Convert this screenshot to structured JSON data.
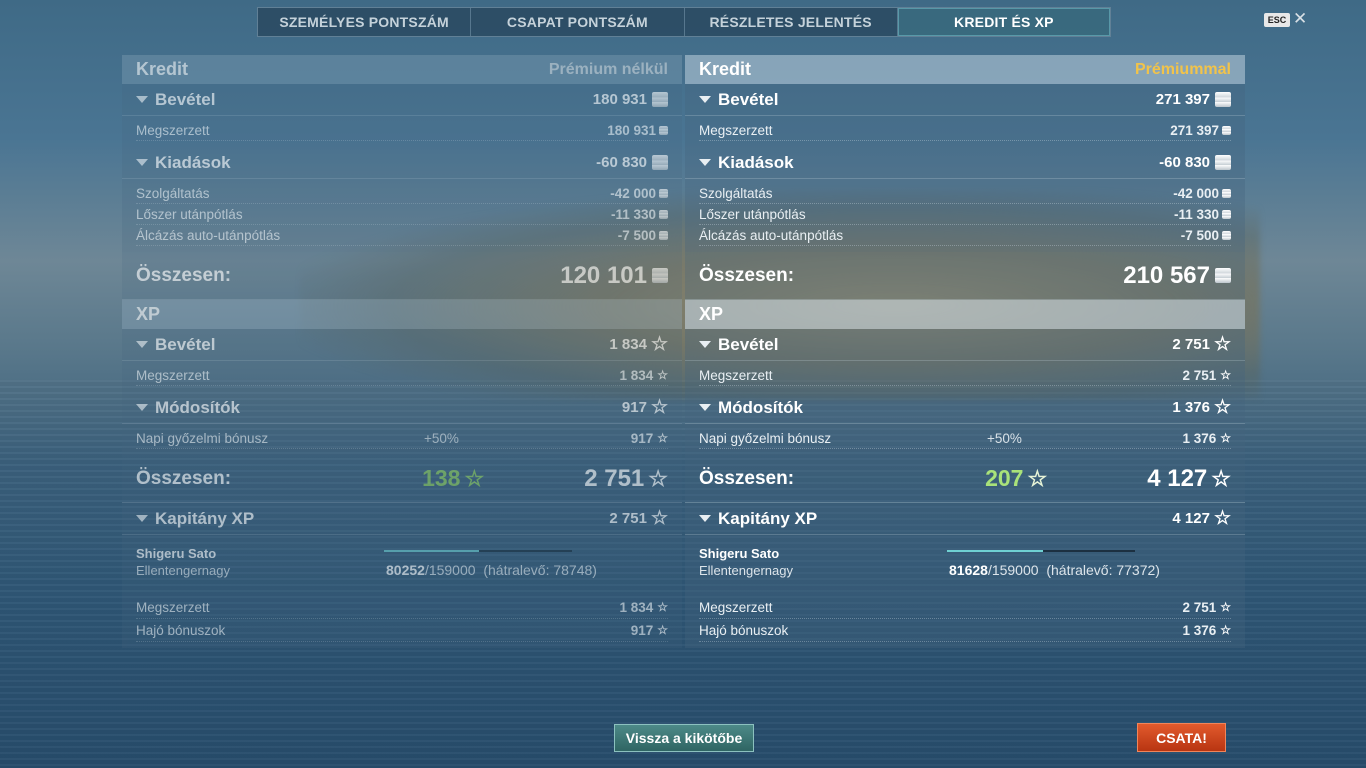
{
  "tabs": [
    "SZEMÉLYES PONTSZÁM",
    "CSAPAT PONTSZÁM",
    "RÉSZLETES JELENTÉS",
    "KREDIT ÉS XP"
  ],
  "active_tab": "KREDIT ÉS XP",
  "esc_label": "ESC",
  "close_symbol": "✕",
  "left": {
    "credit_title": "Kredit",
    "credit_sub": "Prémium nélkül",
    "income_label": "Bevétel",
    "income_value": "180 931",
    "earned_label": "Megszerzett",
    "earned_value": "180 931",
    "expenses_label": "Kiadások",
    "expenses_value": "-60 830",
    "service_label": "Szolgáltatás",
    "service_value": "-42 000",
    "ammo_label": "Lőszer utánpótlás",
    "ammo_value": "-11 330",
    "camo_label": "Álcázás auto-utánpótlás",
    "camo_value": "-7 500",
    "credit_total_label": "Összesen:",
    "credit_total_value": "120 101",
    "xp_title": "XP",
    "xp_income_label": "Bevétel",
    "xp_income_value": "1 834",
    "xp_earned_label": "Megszerzett",
    "xp_earned_value": "1 834",
    "modifiers_label": "Módosítók",
    "modifiers_value": "917",
    "daily_label": "Napi győzelmi bónusz",
    "daily_percent": "+50%",
    "daily_value": "917",
    "xp_total_label": "Összesen:",
    "xp_total_free": "138",
    "xp_total_value": "2 751",
    "captain_label": "Kapitány XP",
    "captain_value": "2 751",
    "captain_name": "Shigeru Sato",
    "captain_role": "Ellentengernagy",
    "captain_current": "80252",
    "captain_max": "/159000",
    "captain_remaining": "(hátralevő: 78748)",
    "captain_progress": 0.505,
    "cap_earned_label": "Megszerzett",
    "cap_earned_value": "1 834",
    "ship_bonus_label": "Hajó bónuszok",
    "ship_bonus_value": "917"
  },
  "right": {
    "credit_title": "Kredit",
    "credit_sub": "Prémiummal",
    "income_label": "Bevétel",
    "income_value": "271 397",
    "earned_label": "Megszerzett",
    "earned_value": "271 397",
    "expenses_label": "Kiadások",
    "expenses_value": "-60 830",
    "service_label": "Szolgáltatás",
    "service_value": "-42 000",
    "ammo_label": "Lőszer utánpótlás",
    "ammo_value": "-11 330",
    "camo_label": "Álcázás auto-utánpótlás",
    "camo_value": "-7 500",
    "credit_total_label": "Összesen:",
    "credit_total_value": "210 567",
    "xp_title": "XP",
    "xp_income_label": "Bevétel",
    "xp_income_value": "2 751",
    "xp_earned_label": "Megszerzett",
    "xp_earned_value": "2 751",
    "modifiers_label": "Módosítók",
    "modifiers_value": "1 376",
    "daily_label": "Napi győzelmi bónusz",
    "daily_percent": "+50%",
    "daily_value": "1 376",
    "xp_total_label": "Összesen:",
    "xp_total_free": "207",
    "xp_total_value": "4 127",
    "captain_label": "Kapitány XP",
    "captain_value": "4 127",
    "captain_name": "Shigeru Sato",
    "captain_role": "Ellentengernagy",
    "captain_current": "81628",
    "captain_max": "/159000",
    "captain_remaining": "(hátralevő: 77372)",
    "captain_progress": 0.513,
    "cap_earned_label": "Megszerzett",
    "cap_earned_value": "2 751",
    "ship_bonus_label": "Hajó bónuszok",
    "ship_bonus_value": "1 376"
  },
  "buttons": {
    "back": "Vissza a kikötőbe",
    "battle": "CSATA!"
  },
  "icons": {
    "credit": "credit-coin-icon",
    "xp": "star-icon",
    "free_xp": "free-xp-star-icon"
  },
  "colors": {
    "premium_label": "#f1c34a",
    "free_xp_green": "#a9e27a",
    "battle_button": "#d14a20",
    "back_button": "#3f7977"
  }
}
